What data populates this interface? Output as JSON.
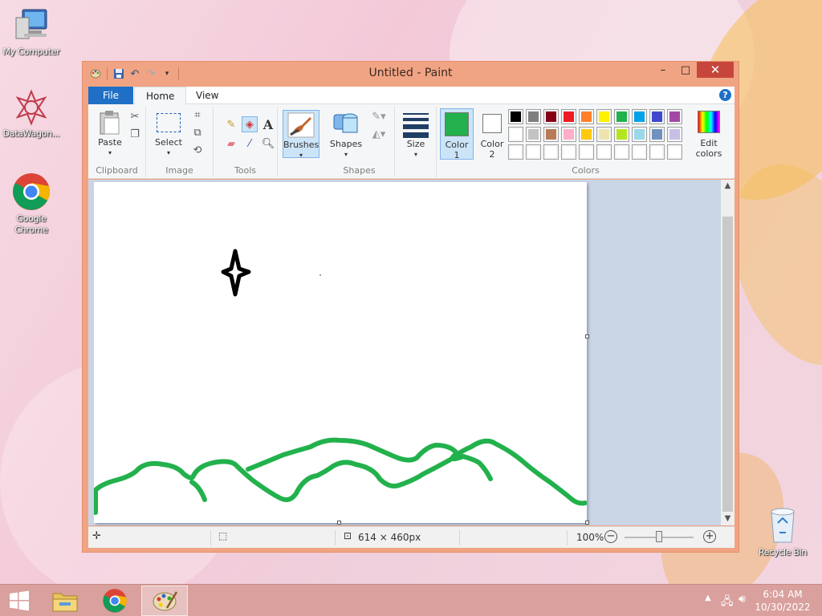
{
  "desktop": {
    "icons": [
      {
        "label": "My Computer",
        "icon": "computer-icon"
      },
      {
        "label": "DataWagon...",
        "icon": "datawagon-icon"
      },
      {
        "label": "Google Chrome",
        "icon": "chrome-icon"
      },
      {
        "label": "Recycle Bin",
        "icon": "recycle-bin-icon"
      }
    ]
  },
  "window": {
    "title": "Untitled - Paint",
    "controls": {
      "minimize": "–",
      "maximize": "□",
      "close": "✕"
    }
  },
  "ribbon": {
    "tabs": [
      {
        "label": "File"
      },
      {
        "label": "Home"
      },
      {
        "label": "View"
      }
    ],
    "help": "?",
    "groups": {
      "clipboard": {
        "name": "Clipboard",
        "paste": "Paste"
      },
      "image": {
        "name": "Image",
        "select": "Select"
      },
      "tools": {
        "name": "Tools"
      },
      "brushes": {
        "label": "Brushes"
      },
      "shapes": {
        "name": "Shapes",
        "label": "Shapes"
      },
      "size": {
        "label": "Size"
      },
      "colors": {
        "name": "Colors",
        "color1_label_1": "Color",
        "color1_label_2": "1",
        "color2_label_1": "Color",
        "color2_label_2": "2",
        "edit_label_1": "Edit",
        "edit_label_2": "colors",
        "color1": "#22b14c",
        "color2": "#ffffff",
        "palette_row1": [
          "#000000",
          "#7f7f7f",
          "#880015",
          "#ed1c24",
          "#ff7f27",
          "#fff200",
          "#22b14c",
          "#00a2e8",
          "#3f48cc",
          "#a349a4"
        ],
        "palette_row2": [
          "#ffffff",
          "#c3c3c3",
          "#b97a57",
          "#ffaec9",
          "#ffc90e",
          "#efe4b0",
          "#b5e61d",
          "#99d9ea",
          "#7092be",
          "#c8bfe7"
        ],
        "palette_row3": [
          "#ffffff",
          "#ffffff",
          "#ffffff",
          "#ffffff",
          "#ffffff",
          "#ffffff",
          "#ffffff",
          "#ffffff",
          "#ffffff",
          "#ffffff"
        ]
      }
    }
  },
  "canvas": {
    "stroke_color": "#22b14c",
    "star_color": "#000000"
  },
  "statusbar": {
    "size_text": "614 × 460px",
    "zoom": "100%",
    "zoom_fraction": 0.5
  },
  "taskbar": {
    "apps": [
      {
        "name": "file-explorer",
        "active": false
      },
      {
        "name": "chrome",
        "active": false
      },
      {
        "name": "paint",
        "active": true
      }
    ],
    "time": "6:04 AM",
    "date": "10/30/2022"
  }
}
